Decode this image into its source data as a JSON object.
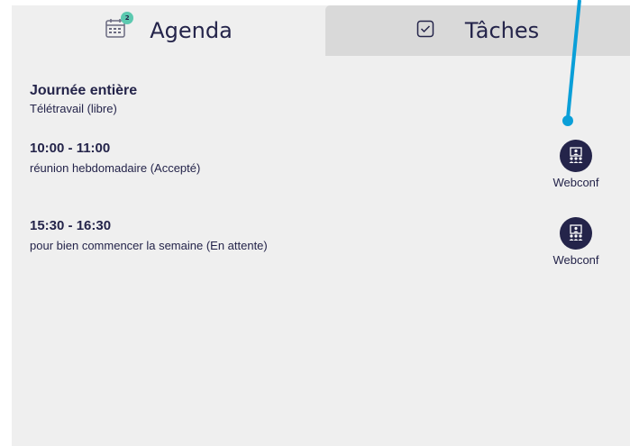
{
  "tabs": {
    "agenda": {
      "label": "Agenda",
      "icon": "calendar-icon",
      "badge": "2"
    },
    "tasks": {
      "label": "Tâches",
      "icon": "checkbox-icon"
    }
  },
  "day": {
    "title": "Journée entière",
    "subtitle": "Télétravail (libre)"
  },
  "events": [
    {
      "time": "10:00 - 11:00",
      "description": "réunion hebdomadaire (Accepté)",
      "action_label": "Webconf",
      "action_icon": "webconf-icon"
    },
    {
      "time": "15:30 - 16:30",
      "description": "pour bien commencer la semaine (En attente)",
      "action_label": "Webconf",
      "action_icon": "webconf-icon"
    }
  ],
  "colors": {
    "text": "#24244a",
    "panel": "#efefef",
    "inactive_tab": "#d9d9d9",
    "badge": "#5cc9b0",
    "pointer": "#0a9fd8"
  }
}
